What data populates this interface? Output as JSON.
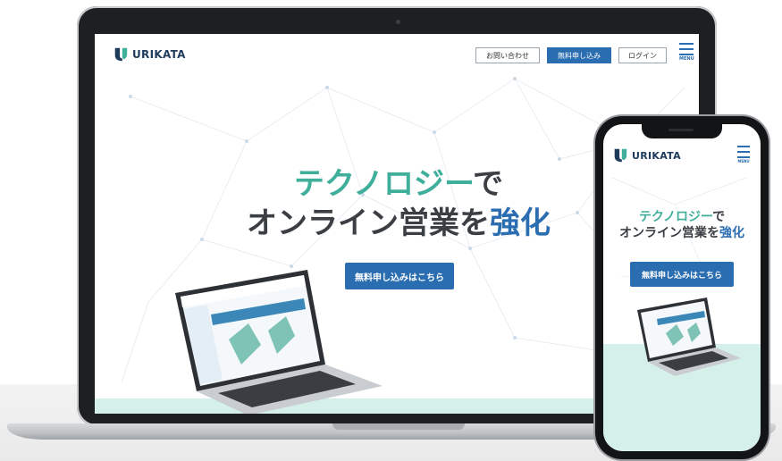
{
  "laptop": {
    "brand": "URIKATA",
    "header_buttons": {
      "contact": "お問い合わせ",
      "apply": "無料申し込み",
      "login": "ログイン"
    },
    "menu_label": "MENU",
    "hero": {
      "line1_green": "テクノロジー",
      "line1_dark": "で",
      "line2_dark": "オンライン営業を",
      "line2_blue": "強化"
    },
    "cta": "無料申し込みはこちら"
  },
  "phone": {
    "brand": "URIKATA",
    "menu_label": "MENU",
    "hero": {
      "line1_green": "テクノロジー",
      "line1_dark": "で",
      "line2_dark": "オンライン営業を",
      "line2_blue": "強化"
    },
    "cta": "無料申し込みはこちら"
  },
  "colors": {
    "primary": "#2a6db0",
    "accent_green": "#3fae9a",
    "text_dark": "#3b3f44",
    "mint": "#d5efe9",
    "brand_navy": "#1f3b5c"
  }
}
